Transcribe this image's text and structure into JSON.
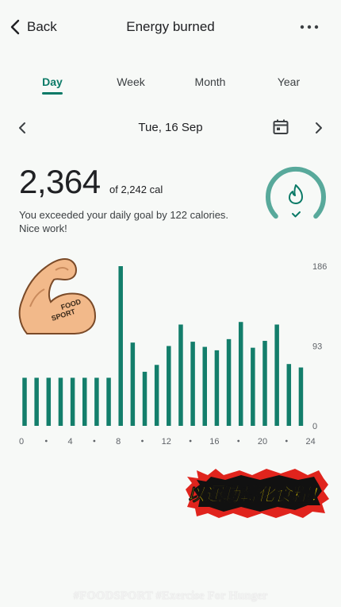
{
  "header": {
    "back_label": "Back",
    "title": "Energy burned",
    "more_icon": "more-vert-icon"
  },
  "tabs": [
    {
      "label": "Day",
      "active": true
    },
    {
      "label": "Week",
      "active": false
    },
    {
      "label": "Month",
      "active": false
    },
    {
      "label": "Year",
      "active": false
    }
  ],
  "date_nav": {
    "label": "Tue, 16 Sep",
    "prev_icon": "chevron-left-icon",
    "next_icon": "chevron-right-icon",
    "calendar_icon": "calendar-icon"
  },
  "summary": {
    "value": "2,364",
    "goal_text": "of 2,242 cal",
    "message": "You exceeded your daily goal by 122 calories. Nice work!",
    "progress_fraction": 1.05
  },
  "colors": {
    "accent": "#0b7a67",
    "bar": "#137e6b",
    "ring": "#58a99b",
    "sticker_red": "#e0241d",
    "sticker_yellow": "#ffe400"
  },
  "chart_data": {
    "type": "bar",
    "categories": [
      "0",
      "1",
      "2",
      "3",
      "4",
      "5",
      "6",
      "7",
      "8",
      "9",
      "10",
      "11",
      "12",
      "13",
      "14",
      "15",
      "16",
      "17",
      "18",
      "19",
      "20",
      "21",
      "22",
      "23"
    ],
    "values": [
      56,
      56,
      56,
      56,
      56,
      56,
      56,
      56,
      186,
      97,
      63,
      71,
      93,
      118,
      98,
      92,
      88,
      101,
      121,
      91,
      99,
      118,
      72,
      68
    ],
    "ylim": [
      0,
      186
    ],
    "y_ticks": [
      {
        "label": "186",
        "value": 186
      },
      {
        "label": "93",
        "value": 93
      },
      {
        "label": "0",
        "value": 0
      }
    ],
    "x_ticks": [
      {
        "label": "0",
        "x": 0
      },
      {
        "label": "4",
        "x": 4
      },
      {
        "label": "8",
        "x": 8
      },
      {
        "label": "12",
        "x": 12
      },
      {
        "label": "16",
        "x": 16
      },
      {
        "label": "20",
        "x": 20
      },
      {
        "label": "24",
        "x": 24
      }
    ],
    "x_dots": [
      2,
      6,
      10,
      14,
      18,
      22
    ]
  },
  "overlay": {
    "muscle_text_1": "FOOD",
    "muscle_text_2": "SPORT",
    "sticker_text": "以運動轉化食糧！",
    "footer_text": "#FOODSPORT #Exercise For Hunger"
  }
}
